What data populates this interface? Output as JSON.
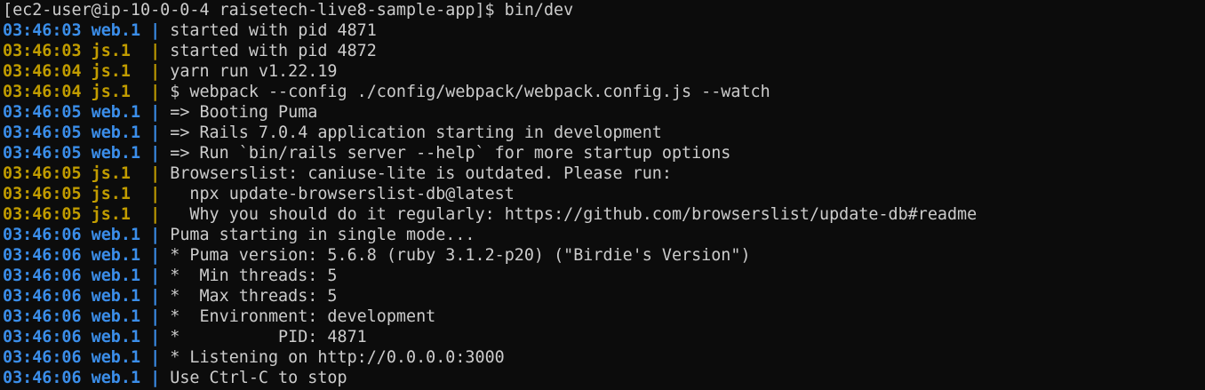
{
  "colors": {
    "background": "#0c0c0c",
    "text": "#cccccc",
    "web": "#3b8eea",
    "js": "#c19c00"
  },
  "terminal": {
    "prompt": "[ec2-user@ip-10-0-0-4 raisetech-live8-sample-app]$ bin/dev",
    "lines": [
      {
        "time": "03:46:03",
        "proc": "web.1",
        "kind": "web",
        "msg": "started with pid 4871"
      },
      {
        "time": "03:46:03",
        "proc": "js.1",
        "kind": "js",
        "msg": "started with pid 4872"
      },
      {
        "time": "03:46:04",
        "proc": "js.1",
        "kind": "js",
        "msg": "yarn run v1.22.19"
      },
      {
        "time": "03:46:04",
        "proc": "js.1",
        "kind": "js",
        "msg": "$ webpack --config ./config/webpack/webpack.config.js --watch"
      },
      {
        "time": "03:46:05",
        "proc": "web.1",
        "kind": "web",
        "msg": "=> Booting Puma"
      },
      {
        "time": "03:46:05",
        "proc": "web.1",
        "kind": "web",
        "msg": "=> Rails 7.0.4 application starting in development"
      },
      {
        "time": "03:46:05",
        "proc": "web.1",
        "kind": "web",
        "msg": "=> Run `bin/rails server --help` for more startup options"
      },
      {
        "time": "03:46:05",
        "proc": "js.1",
        "kind": "js",
        "msg": "Browserslist: caniuse-lite is outdated. Please run:"
      },
      {
        "time": "03:46:05",
        "proc": "js.1",
        "kind": "js",
        "msg": "  npx update-browserslist-db@latest"
      },
      {
        "time": "03:46:05",
        "proc": "js.1",
        "kind": "js",
        "msg": "  Why you should do it regularly: https://github.com/browserslist/update-db#readme"
      },
      {
        "time": "03:46:06",
        "proc": "web.1",
        "kind": "web",
        "msg": "Puma starting in single mode..."
      },
      {
        "time": "03:46:06",
        "proc": "web.1",
        "kind": "web",
        "msg": "* Puma version: 5.6.8 (ruby 3.1.2-p20) (\"Birdie's Version\")"
      },
      {
        "time": "03:46:06",
        "proc": "web.1",
        "kind": "web",
        "msg": "*  Min threads: 5"
      },
      {
        "time": "03:46:06",
        "proc": "web.1",
        "kind": "web",
        "msg": "*  Max threads: 5"
      },
      {
        "time": "03:46:06",
        "proc": "web.1",
        "kind": "web",
        "msg": "*  Environment: development"
      },
      {
        "time": "03:46:06",
        "proc": "web.1",
        "kind": "web",
        "msg": "*          PID: 4871"
      },
      {
        "time": "03:46:06",
        "proc": "web.1",
        "kind": "web",
        "msg": "* Listening on http://0.0.0.0:3000"
      },
      {
        "time": "03:46:06",
        "proc": "web.1",
        "kind": "web",
        "msg": "Use Ctrl-C to stop"
      }
    ]
  }
}
